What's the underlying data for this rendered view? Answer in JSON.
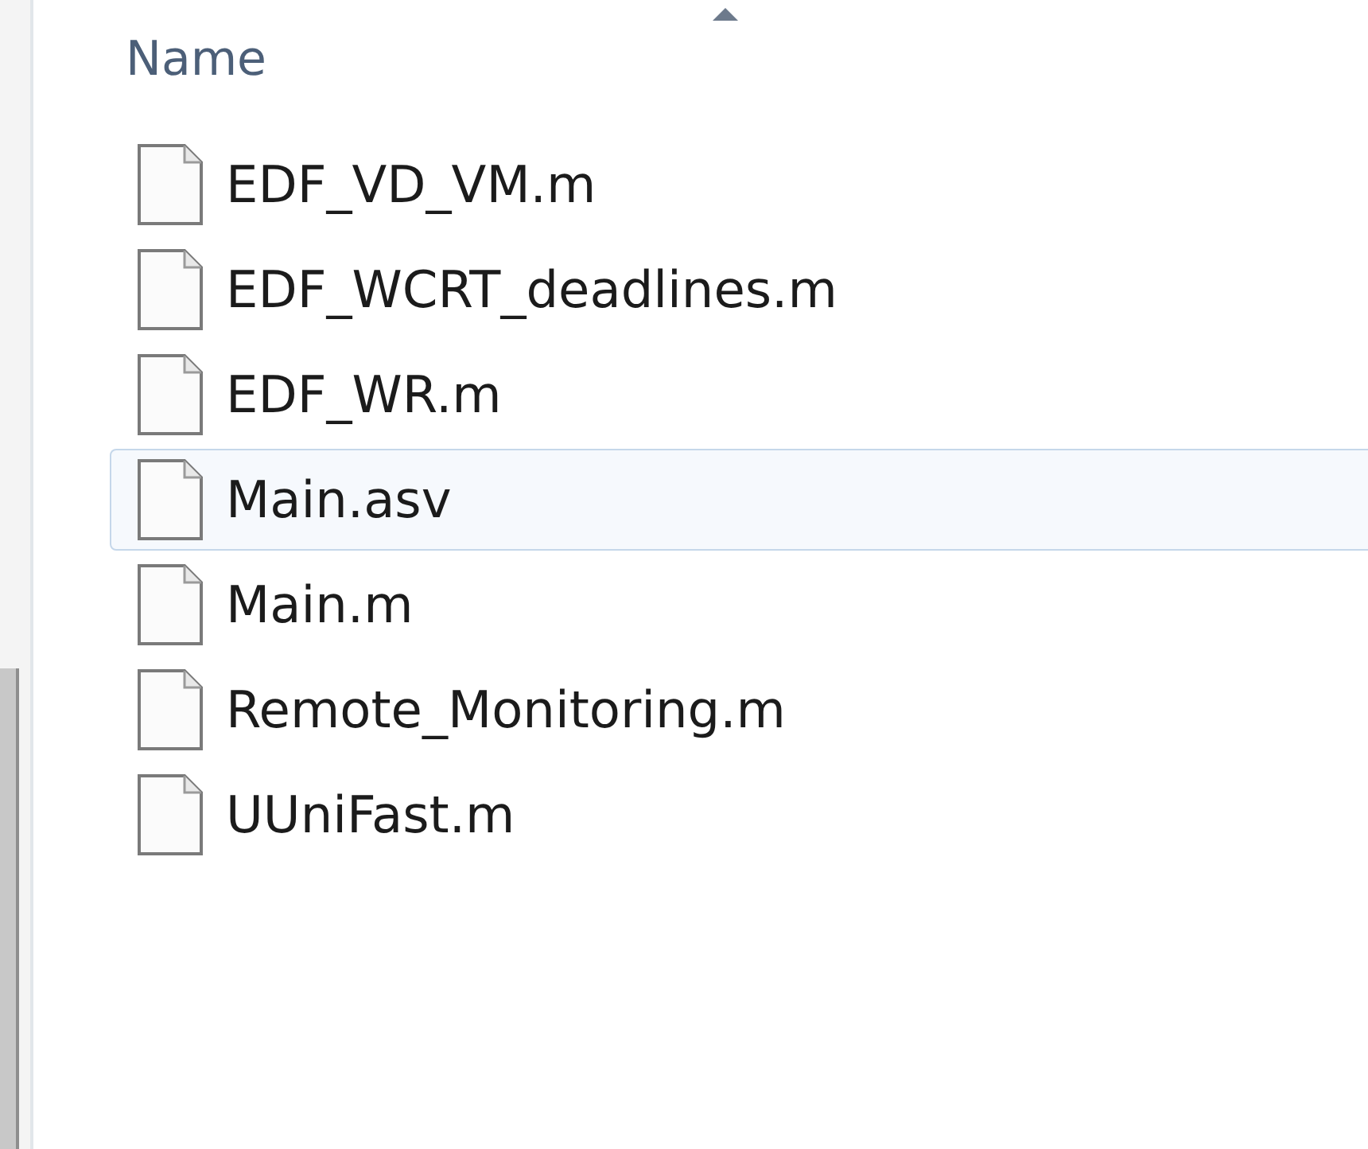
{
  "header": {
    "label": "Name",
    "sort_ascending": true
  },
  "files": [
    {
      "name": "EDF_VD_VM.m",
      "hovered": false
    },
    {
      "name": "EDF_WCRT_deadlines.m",
      "hovered": false
    },
    {
      "name": "EDF_WR.m",
      "hovered": false
    },
    {
      "name": "Main.asv",
      "hovered": true
    },
    {
      "name": "Main.m",
      "hovered": false
    },
    {
      "name": "Remote_Monitoring.m",
      "hovered": false
    },
    {
      "name": "UUniFast.m",
      "hovered": false
    }
  ]
}
